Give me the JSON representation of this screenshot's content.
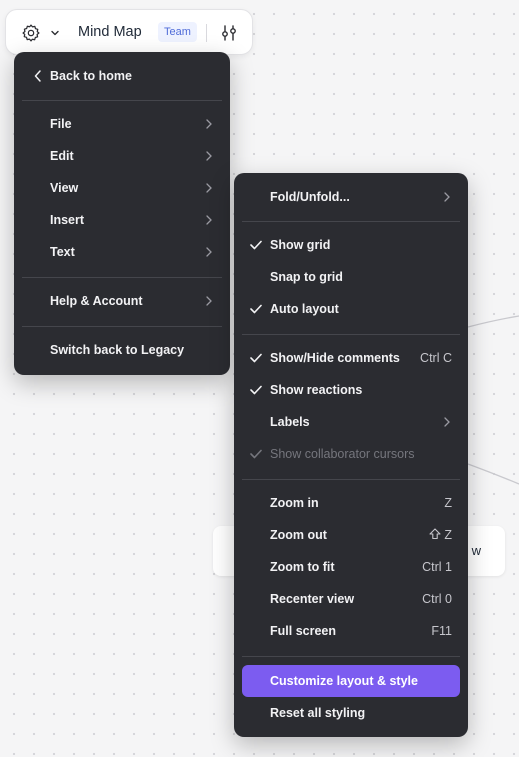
{
  "canvas": {
    "node_text": "w",
    "accent_colors": {
      "line": "#c9c9ce",
      "background": "#f5f5f6"
    }
  },
  "toolbar": {
    "title": "Mind Map",
    "badge": "Team",
    "icons": {
      "settings": "gear-icon",
      "dropdown": "chevron-down-icon",
      "view_settings": "sliders-icon"
    }
  },
  "main_menu": {
    "back": "Back to home",
    "items": [
      {
        "label": "File"
      },
      {
        "label": "Edit"
      },
      {
        "label": "View"
      },
      {
        "label": "Insert"
      },
      {
        "label": "Text"
      }
    ],
    "help": "Help & Account",
    "legacy": "Switch back to Legacy"
  },
  "view_menu": {
    "fold": "Fold/Unfold...",
    "show_grid": {
      "label": "Show grid",
      "checked": true
    },
    "snap_to_grid": {
      "label": "Snap to grid",
      "checked": false
    },
    "auto_layout": {
      "label": "Auto layout",
      "checked": true
    },
    "show_hide_comments": {
      "label": "Show/Hide comments",
      "shortcut": "Ctrl C",
      "checked": true
    },
    "show_reactions": {
      "label": "Show reactions",
      "checked": true
    },
    "labels": {
      "label": "Labels"
    },
    "show_cursors": {
      "label": "Show collaborator cursors",
      "checked": true,
      "disabled": true
    },
    "zoom_in": {
      "label": "Zoom in",
      "shortcut": "Z"
    },
    "zoom_out": {
      "label": "Zoom out",
      "shortcut": "Z",
      "modifier_icon": "shift-icon"
    },
    "zoom_to_fit": {
      "label": "Zoom to fit",
      "shortcut": "Ctrl 1"
    },
    "recenter": {
      "label": "Recenter view",
      "shortcut": "Ctrl 0"
    },
    "full_screen": {
      "label": "Full screen",
      "shortcut": "F11"
    },
    "customize": {
      "label": "Customize layout & style",
      "highlight_color": "#7c5cf0"
    },
    "reset": {
      "label": "Reset all styling"
    }
  }
}
